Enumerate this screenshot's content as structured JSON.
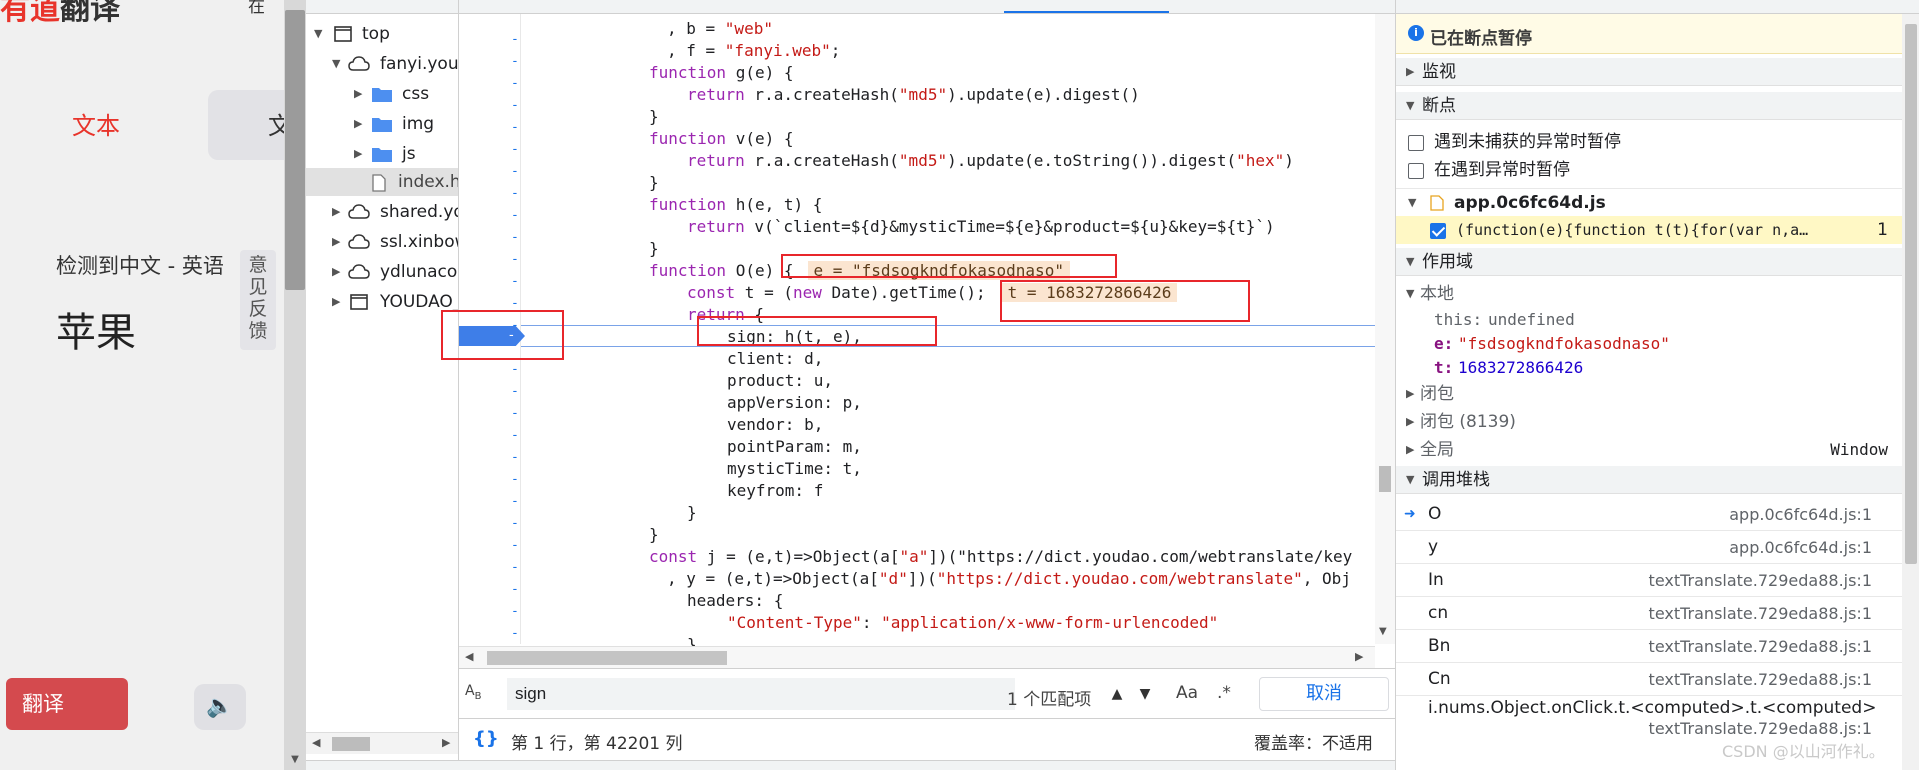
{
  "webpage": {
    "brand_left": "有道",
    "brand_right": "翻译",
    "nav_partial": "在",
    "tab_text": "文本",
    "tab_doc_partial": "文",
    "detect_label": "检测到中文 - 英语",
    "feedback": "意见反馈",
    "source_word": "苹果",
    "translate_button": "翻译"
  },
  "tree": {
    "items": [
      {
        "label": "top",
        "icon": "frame-icon"
      },
      {
        "label": "fanyi.youdao.com",
        "icon": "cloud-icon"
      },
      {
        "label": "css",
        "icon": "folder-icon"
      },
      {
        "label": "img",
        "icon": "folder-icon"
      },
      {
        "label": "js",
        "icon": "folder-icon"
      },
      {
        "label": "index.html",
        "icon": "file-icon"
      },
      {
        "label": "shared.ydstatic.com",
        "icon": "cloud-icon"
      },
      {
        "label": "ssl.xinbow",
        "icon": "cloud-icon"
      },
      {
        "label": "ydlunacommon",
        "icon": "cloud-icon"
      },
      {
        "label": "YOUDAO_",
        "icon": "frame-icon"
      }
    ]
  },
  "editor": {
    "lines": [
      ", b = \"web\"",
      ", f = \"fanyi.web\";",
      "function g(e) {",
      "return r.a.createHash(\"md5\").update(e).digest()",
      "}",
      "function v(e) {",
      "return r.a.createHash(\"md5\").update(e.toString()).digest(\"hex\")",
      "}",
      "function h(e, t) {",
      "return v(`client=${d}&mysticTime=${e}&product=${u}&key=${t}`)",
      "}",
      "function O(e) {",
      "const t = (new Date).getTime();",
      "return {",
      "sign: h(t, e),",
      "client: d,",
      "product: u,",
      "appVersion: p,",
      "vendor: b,",
      "pointParam: m,",
      "mysticTime: t,",
      "keyfrom: f",
      "}",
      "}",
      "const j = (e,t)=>Object(a[\"a\"])(\"https://dict.youdao.com/webtranslate/key",
      ", y = (e,t)=>Object(a[\"d\"])(\"https://dict.youdao.com/webtranslate\", Obj",
      "headers: {",
      "\"Content-Type\": \"application/x-www-form-urlencoded\"",
      "}"
    ],
    "inline_e": "e = \"fsdsogkndfokasodnaso\"",
    "inline_t": "t = 1683272866426",
    "gutter_mark": "-"
  },
  "search": {
    "value": "sign",
    "match_count": "1 个匹配项",
    "case_label": "Aa",
    "regex_label": ".*",
    "cancel": "取消"
  },
  "status": {
    "braces": "{}",
    "position": "第 1 行，第 42201 列",
    "coverage": "覆盖率：不适用"
  },
  "debugger": {
    "paused": "已在断点暂停",
    "watch": "监视",
    "breakpoints": "断点",
    "pause_uncaught": "遇到未捕获的异常时暂停",
    "pause_caught": "在遇到异常时暂停",
    "bp_file": "app.0c6fc64d.js",
    "bp_code": "(function(e){function t(t){for(var n,a…",
    "bp_line": "1",
    "scope": "作用域",
    "local": "本地",
    "this_key": "this:",
    "this_val": "undefined",
    "e_key": "e:",
    "e_val": "\"fsdsogkndfokasodnaso\"",
    "t_key": "t:",
    "t_val": "1683272866426",
    "closure1": "闭包",
    "closure2": "闭包 (8139)",
    "global": "全局",
    "global_val": "Window",
    "callstack": "调用堆栈",
    "frames": [
      {
        "fn": "O",
        "loc": "app.0c6fc64d.js:1"
      },
      {
        "fn": "y",
        "loc": "app.0c6fc64d.js:1"
      },
      {
        "fn": "In",
        "loc": "textTranslate.729eda88.js:1"
      },
      {
        "fn": "cn",
        "loc": "textTranslate.729eda88.js:1"
      },
      {
        "fn": "Bn",
        "loc": "textTranslate.729eda88.js:1"
      },
      {
        "fn": "Cn",
        "loc": "textTranslate.729eda88.js:1"
      }
    ],
    "last_fn": "i.nums.Object.onClick.t.<computed>.t.<computed>",
    "last_loc": "textTranslate.729eda88.js:1"
  },
  "watermark": "CSDN @以山河作礼。",
  "colors": {
    "accent": "#1a73e8",
    "annotation": "#e8262b",
    "brand": "#e8342b"
  }
}
